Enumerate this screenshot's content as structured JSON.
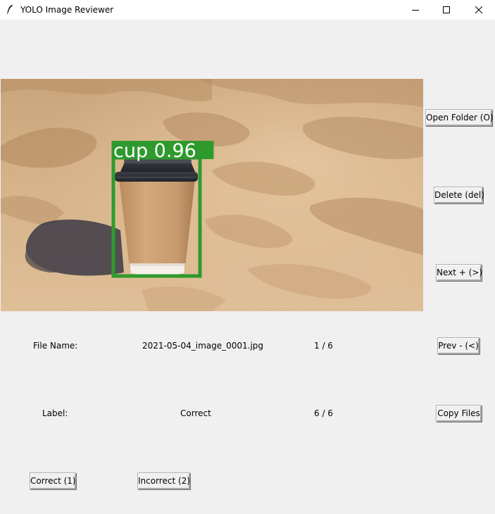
{
  "window": {
    "title": "YOLO Image Reviewer"
  },
  "image": {
    "detection": {
      "label": "cup 0.96",
      "class": "cup",
      "confidence": 0.96,
      "box_color": "#2e9a2e"
    }
  },
  "buttons": {
    "open_folder": "Open Folder (O)",
    "delete": "Delete (del)",
    "next": "Next + (>)",
    "prev": "Prev - (<)",
    "copy_files": "Copy Files",
    "correct": "Correct (1)",
    "incorrect": "Incorrect (2)"
  },
  "info": {
    "file_name_label": "File Name:",
    "file_name": "2021-05-04_image_0001.jpg",
    "image_index": "1 / 6",
    "label_label": "Label:",
    "label_value": "Correct",
    "labeled_count": "6 / 6"
  },
  "icons": {
    "app": "feather-icon",
    "minimize": "minimize-icon",
    "maximize": "maximize-icon",
    "close": "close-icon"
  },
  "colors": {
    "window_bg": "#f0f0f0",
    "titlebar_bg": "#ffffff",
    "detection_green": "#2e9a2e"
  }
}
